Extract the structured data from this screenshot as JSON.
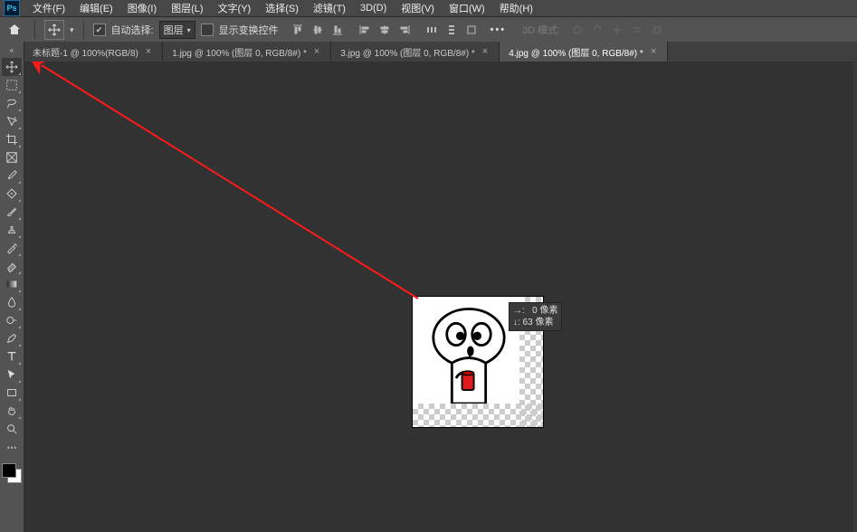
{
  "menu": {
    "items": [
      "文件(F)",
      "编辑(E)",
      "图像(I)",
      "图层(L)",
      "文字(Y)",
      "选择(S)",
      "滤镜(T)",
      "3D(D)",
      "视图(V)",
      "窗口(W)",
      "帮助(H)"
    ]
  },
  "options": {
    "auto_select_label": "自动选择:",
    "auto_select_value": "图层",
    "show_transform_label": "显示变换控件",
    "mode3d_label": "3D 模式:"
  },
  "tabs": [
    {
      "label": "未标题-1 @ 100%(RGB/8)",
      "active": false
    },
    {
      "label": "1.jpg @ 100% (图层 0, RGB/8#) *",
      "active": false
    },
    {
      "label": "3.jpg @ 100% (图层 0, RGB/8#) *",
      "active": false
    },
    {
      "label": "4.jpg @ 100% (图层 0, RGB/8#) *",
      "active": true
    }
  ],
  "tooltip": {
    "line1": "→:   0 像素",
    "line2": "↓: 63 像素"
  },
  "colors": {
    "accent_red": "#ff1a1a"
  },
  "tools": [
    "move",
    "marquee",
    "lasso",
    "quick-select",
    "crop",
    "frame",
    "eyedropper",
    "spot-heal",
    "brush",
    "clone",
    "history-brush",
    "eraser",
    "gradient",
    "blur",
    "dodge",
    "pen",
    "type",
    "path-select",
    "rectangle",
    "hand",
    "zoom"
  ]
}
